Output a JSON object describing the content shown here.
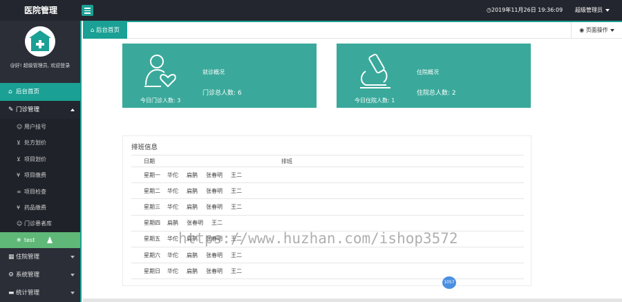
{
  "app": {
    "brand": "医院管理"
  },
  "header": {
    "datetime": "2019年11月26日 19:36:09",
    "user": "超级管理员"
  },
  "sidebar": {
    "greeting": "@好! 超级管理员, 欢迎登录",
    "home": "后台首页",
    "outpatient": {
      "label": "门诊管理",
      "items": [
        {
          "label": "用户挂号"
        },
        {
          "label": "处方划价"
        },
        {
          "label": "项目划价"
        },
        {
          "label": "项目缴费"
        },
        {
          "label": "项目检查"
        },
        {
          "label": "药品缴费"
        },
        {
          "label": "门诊患者库"
        },
        {
          "label": "test"
        }
      ]
    },
    "inpatient": "住院管理",
    "system": "系统管理",
    "statistics": "统计管理"
  },
  "tabs": {
    "home": "后台首页",
    "page_ops": "页面操作"
  },
  "cards": {
    "outpatient": {
      "sub_label": "今日门诊人数: 3",
      "title": "就诊概况",
      "total": "门诊总人数: 6"
    },
    "inpatient": {
      "sub_label": "今日住院人数: 1",
      "title": "住院概况",
      "total": "住院总人数: 2"
    }
  },
  "schedule": {
    "title": "排班信息",
    "col_date": "日期",
    "col_shift": "排班",
    "rows": [
      {
        "day": "星期一",
        "doctors": [
          "华佗",
          "扁鹊",
          "张春明",
          "王二"
        ]
      },
      {
        "day": "星期二",
        "doctors": [
          "华佗",
          "扁鹊",
          "张春明",
          "王二"
        ]
      },
      {
        "day": "星期三",
        "doctors": [
          "华佗",
          "扁鹊",
          "张春明",
          "王二"
        ]
      },
      {
        "day": "星期四",
        "doctors": [
          "扁鹊",
          "张春明",
          "王二"
        ]
      },
      {
        "day": "星期五",
        "doctors": [
          "华佗",
          "扁鹊",
          "张春明",
          "王二"
        ]
      },
      {
        "day": "星期六",
        "doctors": [
          "华佗",
          "扁鹊",
          "张春明",
          "王二"
        ]
      },
      {
        "day": "星期日",
        "doctors": [
          "华佗",
          "扁鹊",
          "张春明",
          "王二"
        ]
      }
    ]
  },
  "badge": "1057",
  "watermark": "https://www.huzhan.com/ishop3572",
  "colors": {
    "accent": "#1aa094",
    "card": "#3aa99b",
    "sidebar": "#2b2e37",
    "topbar": "#23262e",
    "highlight": "#5fb878"
  }
}
